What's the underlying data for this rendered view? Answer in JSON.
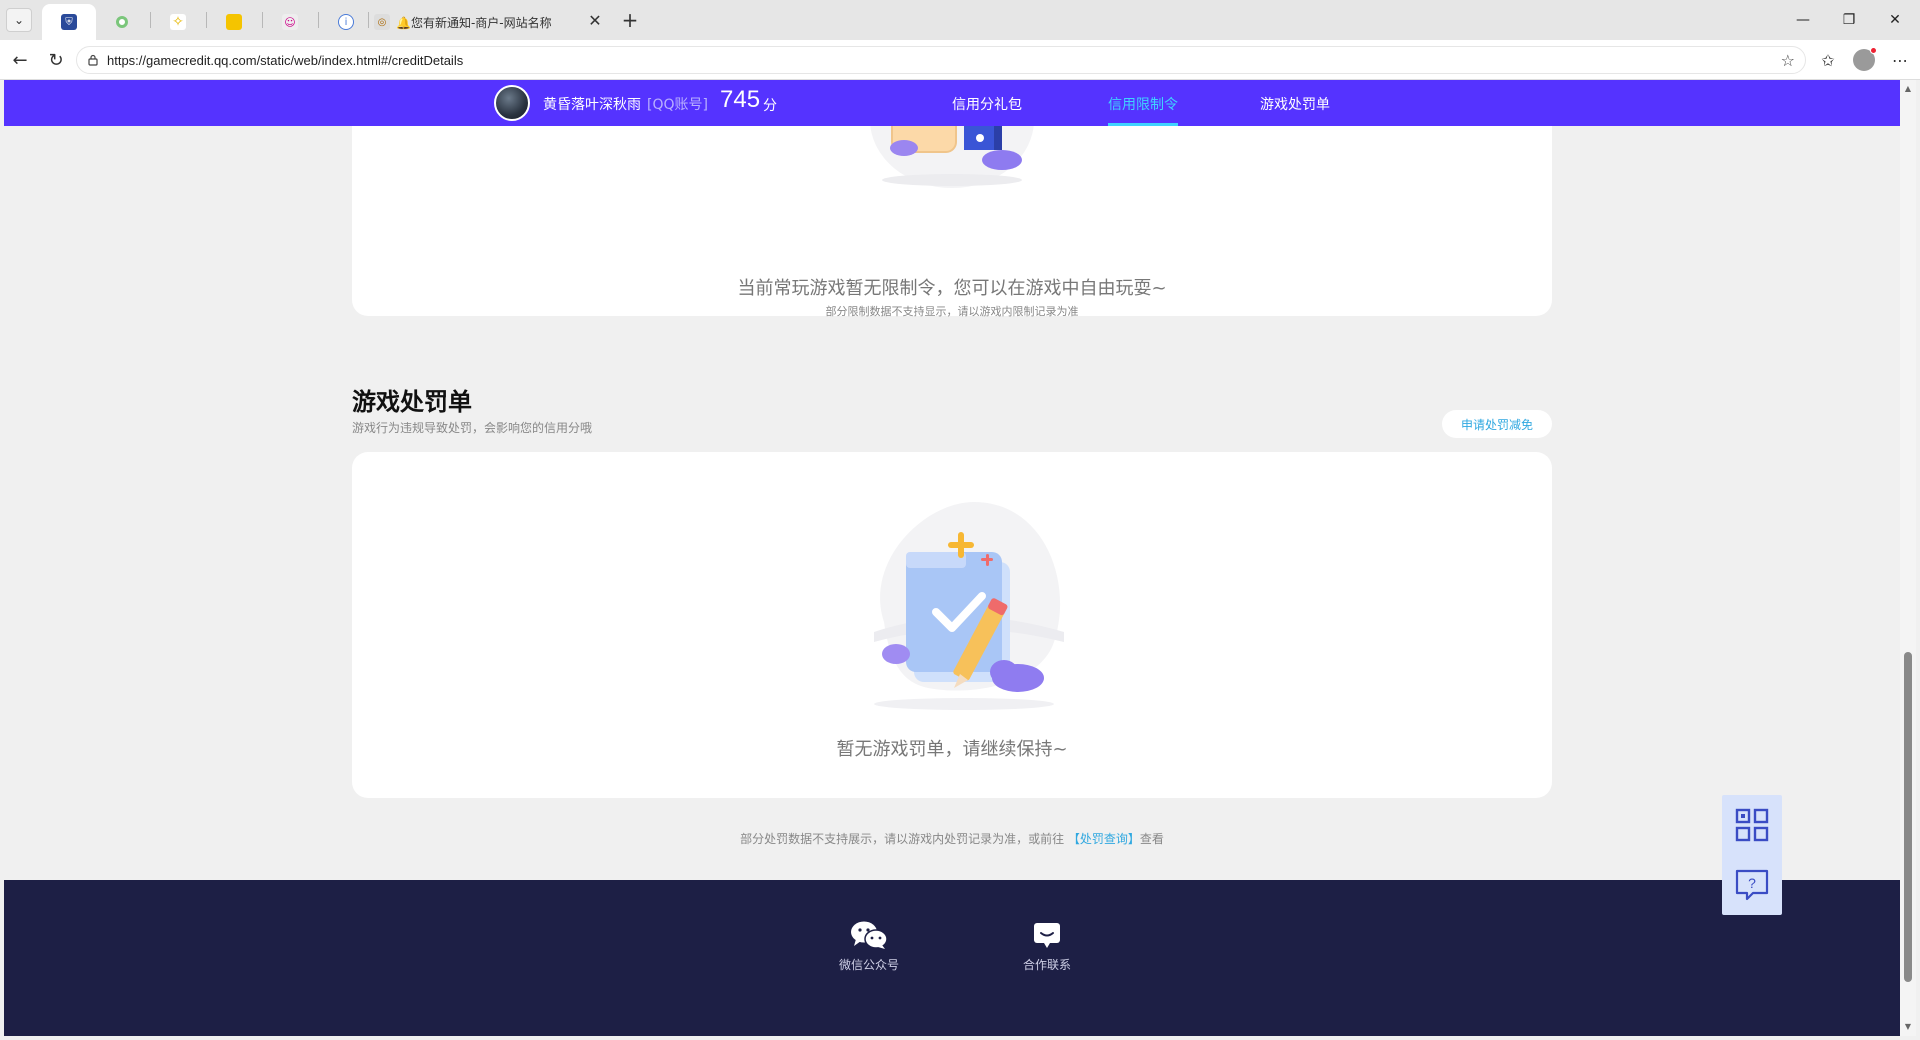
{
  "browser": {
    "active_tab_title": "🔔您有新通知-商户-网站名称",
    "url": "https://gamecredit.qq.com/static/web/index.html#/creditDetails"
  },
  "header": {
    "user_name": "黄昏落叶深秋雨",
    "account_type": "[QQ账号]",
    "score": "745",
    "score_unit": "分",
    "nav": [
      {
        "label": "信用分礼包"
      },
      {
        "label": "信用限制令"
      },
      {
        "label": "游戏处罚单"
      }
    ]
  },
  "restriction": {
    "empty_message": "当前常玩游戏暂无限制令，您可以在游戏中自由玩耍~",
    "note": "部分限制数据不支持显示，请以游戏内限制记录为准"
  },
  "penalty": {
    "title": "游戏处罚单",
    "description": "游戏行为违规导致处罚，会影响您的信用分哦",
    "apply_button": "申请处罚减免",
    "empty_message": "暂无游戏罚单，请继续保持~",
    "footnote_prefix": "部分处罚数据不支持展示，请以游戏内处罚记录为准，或前往",
    "footnote_link": "【处罚查询】",
    "footnote_suffix": "查看"
  },
  "footer": {
    "items": [
      {
        "label": "微信公众号"
      },
      {
        "label": "合作联系"
      }
    ]
  },
  "colors": {
    "header_bg": "#5533ff",
    "active_nav": "#3fd3ff",
    "link": "#30a8e0",
    "footer_bg": "#1d1f45"
  }
}
